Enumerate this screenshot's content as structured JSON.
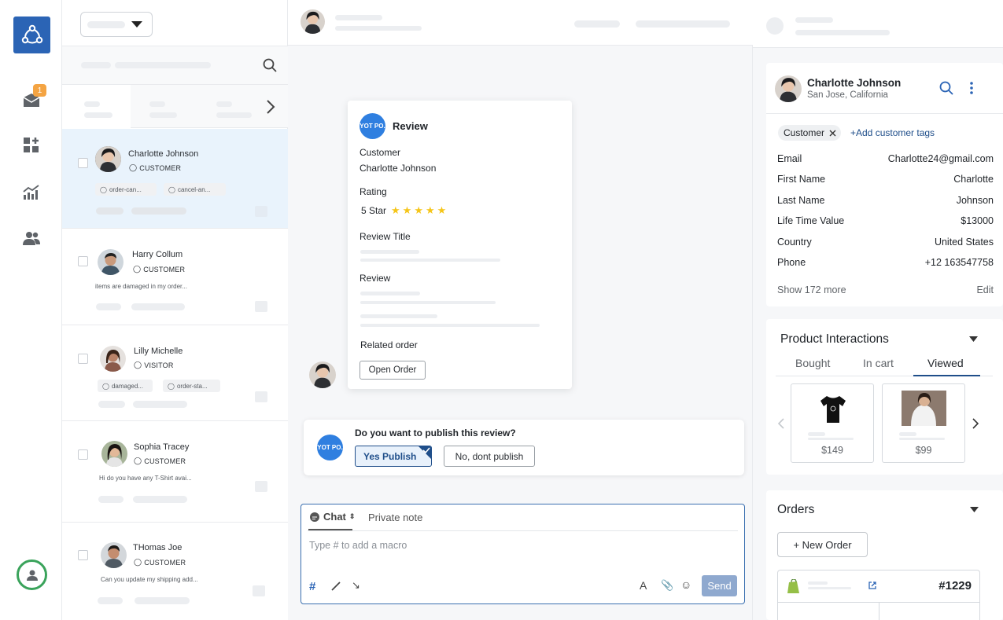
{
  "sidebar": {
    "inbox_badge": "1"
  },
  "conversations": [
    {
      "name": "Charlotte Johnson",
      "role": "CUSTOMER",
      "tags": [
        "order-can...",
        "cancel-an..."
      ],
      "preview": ""
    },
    {
      "name": "Harry Collum",
      "role": "CUSTOMER",
      "tags": [],
      "preview": "items are damaged in my order..."
    },
    {
      "name": "Lilly Michelle",
      "role": "VISITOR",
      "tags": [
        "damaged...",
        "order-sta..."
      ],
      "preview": ""
    },
    {
      "name": "Sophia Tracey",
      "role": "CUSTOMER",
      "tags": [],
      "preview": "Hi do you have any T-Shirt avai..."
    },
    {
      "name": "THomas Joe",
      "role": "CUSTOMER",
      "tags": [],
      "preview": "Can you update my shipping add..."
    }
  ],
  "review_card": {
    "brand": "YOT PO.",
    "title": "Review",
    "customer_label": "Customer",
    "customer_value": "Charlotte Johnson",
    "rating_label": "Rating",
    "rating_value": "5 Star",
    "rating_stars": 5,
    "review_title_label": "Review Title",
    "review_label": "Review",
    "related_order_label": "Related order",
    "open_order_button": "Open Order"
  },
  "publish_prompt": {
    "brand": "YOT PO.",
    "question": "Do you want to publish this review?",
    "yes_button": "Yes Publish",
    "no_button": "No, dont publish"
  },
  "composer": {
    "tab_chat": "Chat",
    "tab_private": "Private note",
    "placeholder": "Type # to add a macro",
    "send_button": "Send"
  },
  "profile": {
    "name": "Charlotte Johnson",
    "location": "San Jose, California",
    "tag": "Customer",
    "add_tags": "+Add customer tags",
    "fields": [
      {
        "label": "Email",
        "value": "Charlotte24@gmail.com"
      },
      {
        "label": "First Name",
        "value": "Charlotte"
      },
      {
        "label": "Last Name",
        "value": "Johnson"
      },
      {
        "label": "Life Time Value",
        "value": "$13000"
      },
      {
        "label": "Country",
        "value": "United States"
      },
      {
        "label": "Phone",
        "value": "+12 163547758"
      }
    ],
    "show_more": "Show 172 more",
    "edit": "Edit"
  },
  "product_interactions": {
    "title": "Product Interactions",
    "tabs": [
      "Bought",
      "In cart",
      "Viewed"
    ],
    "active_tab": "Viewed",
    "products": [
      {
        "price": "$149"
      },
      {
        "price": "$99"
      }
    ]
  },
  "orders": {
    "title": "Orders",
    "new_order_button": "+ New Order",
    "order_number": "#1229"
  },
  "colors": {
    "brand_blue": "#2b64b5",
    "yotpo_blue": "#2f7fe0",
    "accent_navy": "#1f4e8a",
    "selected_row": "#e9f3fc",
    "badge_orange": "#f4a443",
    "online_green": "#3aa35b"
  }
}
